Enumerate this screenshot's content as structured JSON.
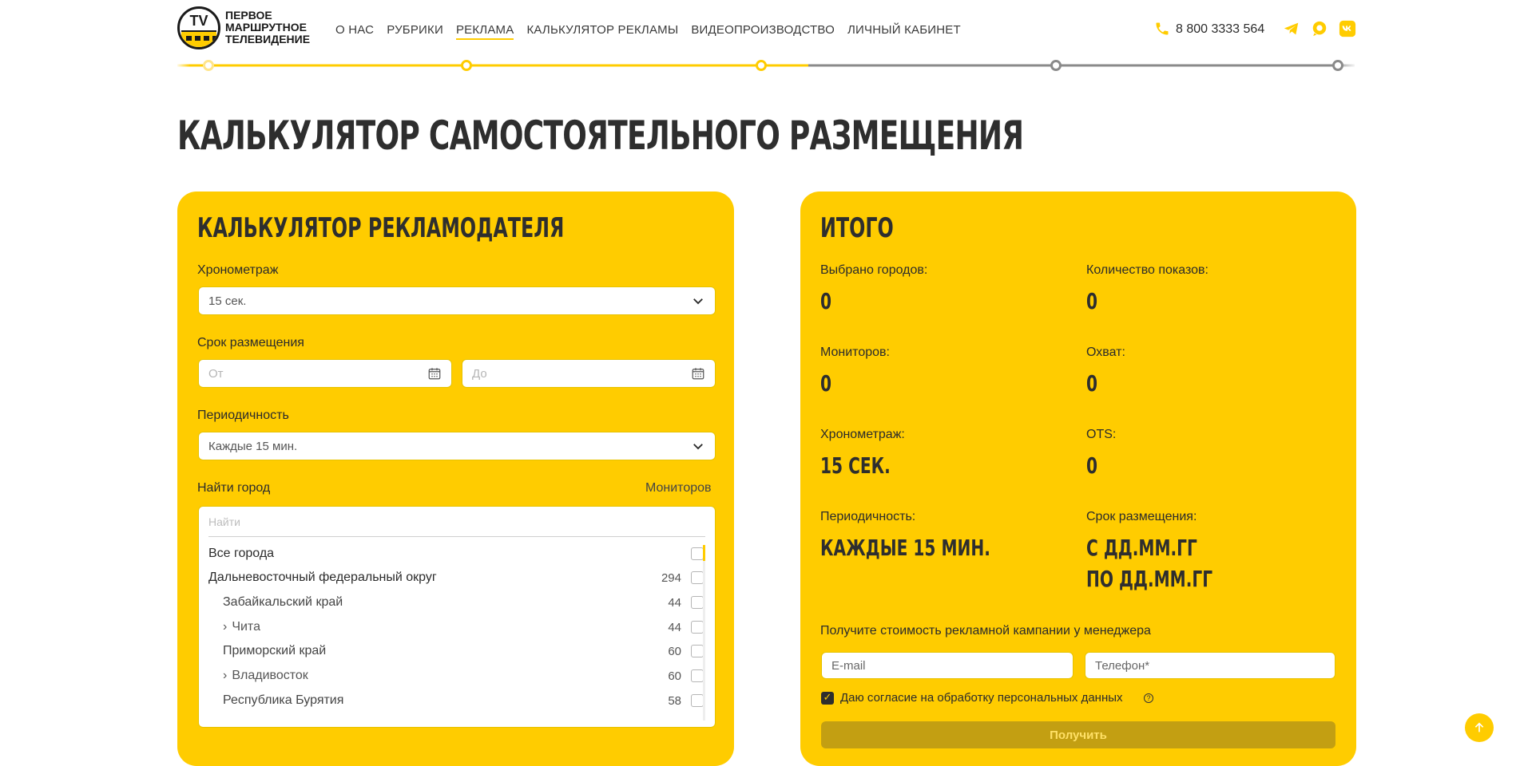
{
  "header": {
    "logo": {
      "badge": "TV",
      "line1": "ПЕРВОЕ",
      "line2": "МАРШРУТНОЕ",
      "line3": "ТЕЛЕВИДЕНИЕ"
    },
    "nav": [
      {
        "label": "О НАС"
      },
      {
        "label": "РУБРИКИ"
      },
      {
        "label": "РЕКЛАМА"
      },
      {
        "label": "КАЛЬКУЛЯТОР РЕКЛАМЫ"
      },
      {
        "label": "ВИДЕОПРОИЗВОДСТВО"
      },
      {
        "label": "ЛИЧНЫЙ КАБИНЕТ"
      }
    ],
    "active_nav": "РЕКЛАМА",
    "phone": "8 800 3333 564",
    "social_icons": [
      "telegram-icon",
      "chat-icon",
      "vk-icon"
    ]
  },
  "colors": {
    "accent": "#ffcc00",
    "dark": "#2e2e2e",
    "line_gray": "#8a8a8a",
    "button": "#c39f12"
  },
  "page_title": "КАЛЬКУЛЯТОР САМОСТОЯТЕЛЬНОГО РАЗМЕЩЕНИЯ",
  "calc": {
    "title": "КАЛЬКУЛЯТОР РЕКЛАМОДАТЕЛЯ",
    "duration_label": "Хронометраж",
    "duration_value": "15 сек.",
    "period_label": "Срок размещения",
    "from_placeholder": "От",
    "to_placeholder": "До",
    "frequency_label": "Периодичность",
    "frequency_value": "Каждые 15 мин.",
    "city_label": "Найти город",
    "monitors_label": "Мониторов",
    "search_placeholder": "Найти",
    "rows": [
      {
        "name": "Все города",
        "count": ""
      },
      {
        "name": "Дальневосточный федеральный округ",
        "count": "294"
      },
      {
        "name": "Забайкальский край",
        "count": "44"
      },
      {
        "name": "Чита",
        "count": "44"
      },
      {
        "name": "Приморский край",
        "count": "60"
      },
      {
        "name": "Владивосток",
        "count": "60"
      },
      {
        "name": "Республика Бурятия",
        "count": "58"
      }
    ]
  },
  "summary": {
    "title": "ИТОГО",
    "cities_label": "Выбрано городов:",
    "cities_value": "0",
    "shows_label": "Количество показов:",
    "shows_value": "0",
    "monitors_label": "Мониторов:",
    "monitors_value": "0",
    "reach_label": "Охват:",
    "reach_value": "0",
    "duration_label": "Хронометраж:",
    "duration_value": "15 сек.",
    "ots_label": "OTS:",
    "ots_value": "0",
    "frequency_label": "Периодичность:",
    "frequency_value": "Каждые 15 мин.",
    "period_label": "Срок размещения:",
    "period_from": "с дд.мм.гг",
    "period_to": "по дд.мм.гг",
    "request_label": "Получите стоимость рекламной кампании у менеджера",
    "email_placeholder": "E-mail",
    "phone_placeholder": "Телефон*",
    "consent_label": "Даю согласие на обработку персональных данных",
    "consent_checked": true,
    "submit_label": "Получить"
  }
}
